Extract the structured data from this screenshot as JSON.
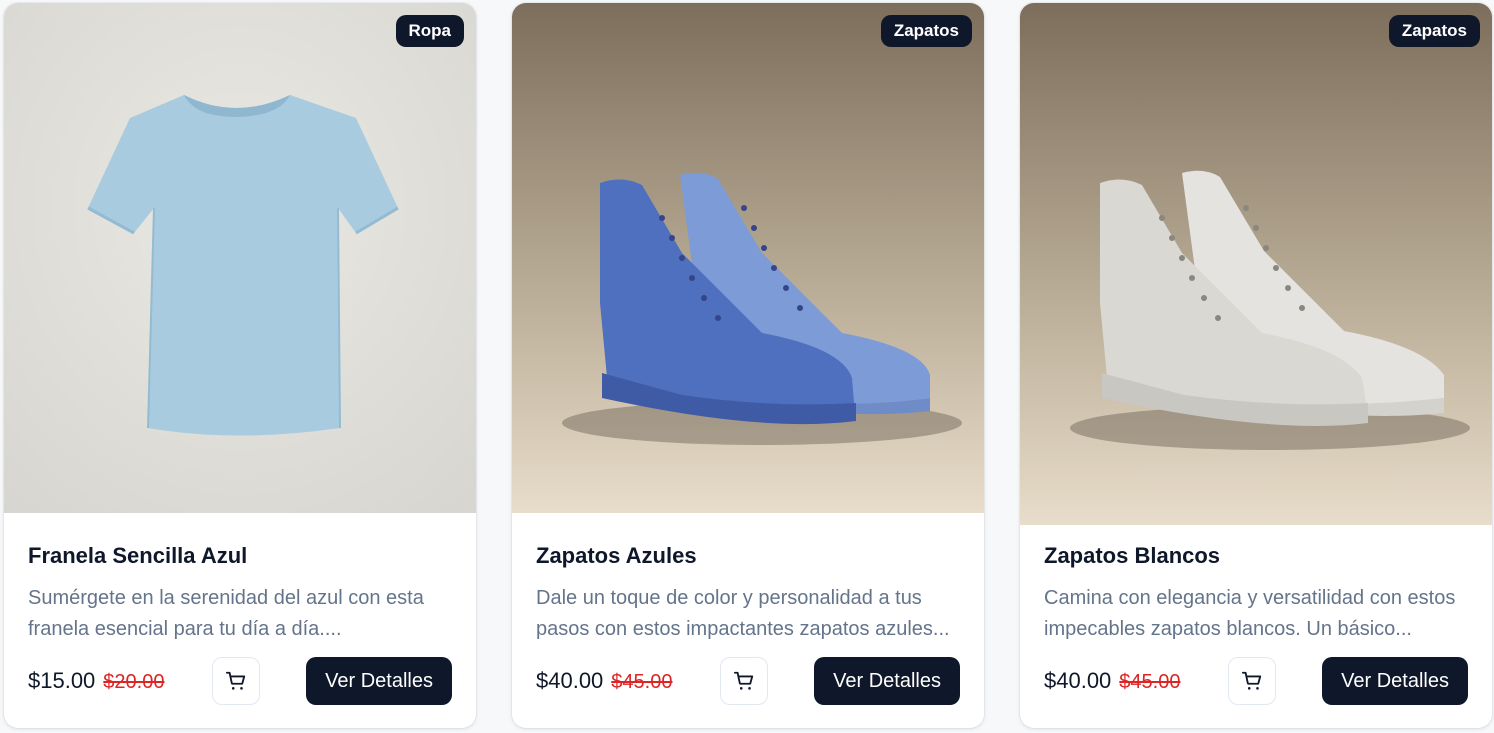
{
  "products": [
    {
      "category": "Ropa",
      "title": "Franela Sencilla Azul",
      "description": "Sumérgete en la serenidad del azul con esta franela esencial para tu día a día....",
      "price": "$15.00",
      "old_price": "$20.00",
      "details_label": "Ver Detalles",
      "image_icon": "light-blue-tshirt"
    },
    {
      "category": "Zapatos",
      "title": "Zapatos Azules",
      "description": "Dale un toque de color y personalidad a tus pasos con estos impactantes zapatos azules...",
      "price": "$40.00",
      "old_price": "$45.00",
      "details_label": "Ver Detalles",
      "image_icon": "blue-high-top-sneakers"
    },
    {
      "category": "Zapatos",
      "title": "Zapatos Blancos",
      "description": "Camina con elegancia y versatilidad con estos impecables zapatos blancos. Un básico...",
      "price": "$40.00",
      "old_price": "$45.00",
      "details_label": "Ver Detalles",
      "image_icon": "white-high-top-sneakers"
    }
  ],
  "colors": {
    "accent": "#0f172a",
    "old_price": "#dc2626",
    "muted_text": "#64748b"
  }
}
